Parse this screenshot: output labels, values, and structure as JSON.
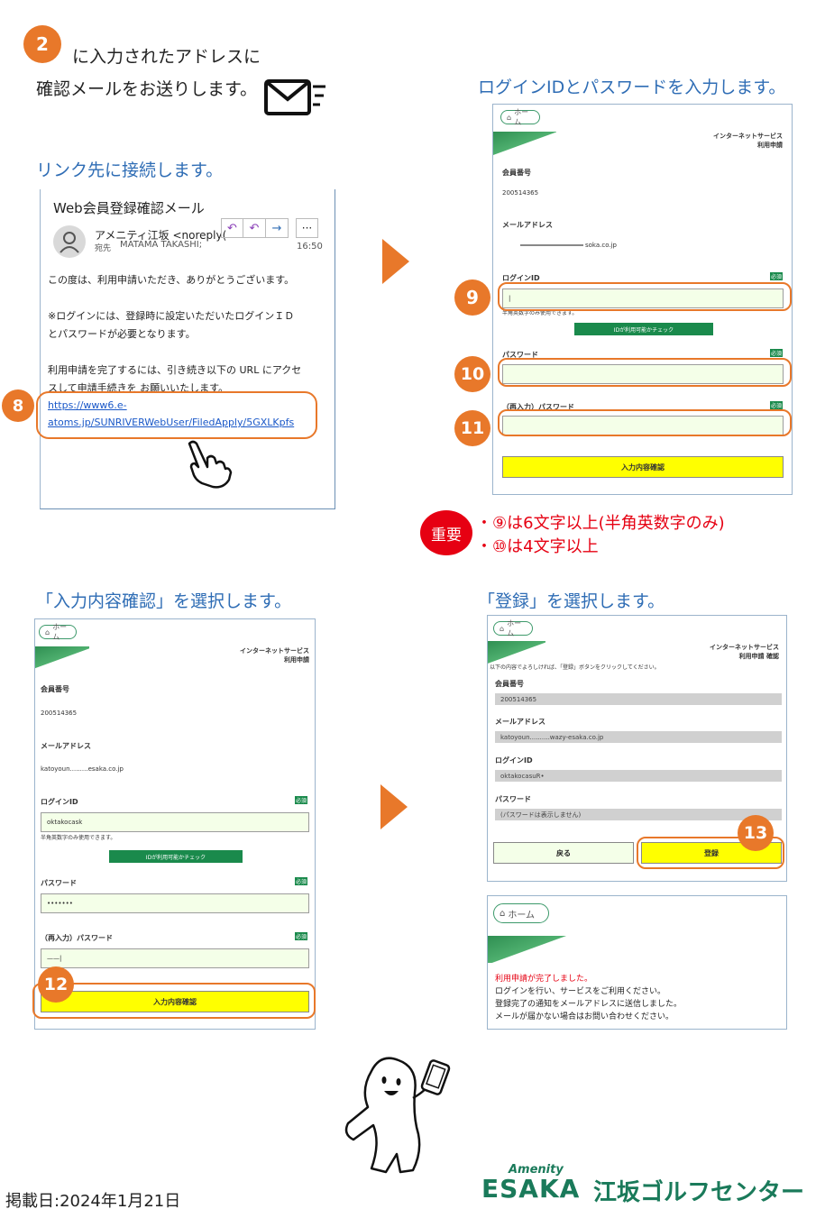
{
  "step2": {
    "number": "2",
    "line1": "に入力されたアドレスに",
    "line2": "確認メールをお送りします。"
  },
  "captions": {
    "link": "リンク先に接続します。",
    "login": "ログインIDとパスワードを入力します。",
    "confirm": "「入力内容確認」を選択します。",
    "register": "「登録」を選択します。"
  },
  "email": {
    "subject": "Web会員登録確認メール",
    "from": "アメニティ江坂 <noreply(",
    "to_label": "宛先",
    "to_value": "MATAMA TAKASHI;",
    "time": "16:50",
    "body1": "この度は、利用申請いただき、ありがとうございます。",
    "body2a": "※ログインには、登録時に設定いただいたログインＩＤ",
    "body2b": "とパスワードが必要となります。",
    "body3a": "利用申請を完了するには、引き続き以下の URL にアクセ",
    "body3b": "スして申請手続きを お願いいたします。",
    "link_a": "https://www6.e-",
    "link_b": "atoms.jp/SUNRIVERWebUser/FiledApply/5GXLKpfs"
  },
  "steps": {
    "s8": "8",
    "s9": "9",
    "s10": "10",
    "s11": "11",
    "s12": "12",
    "s13": "13"
  },
  "form1": {
    "home": "ホーム",
    "service": "インターネットサービス",
    "service_sub": "利用申請",
    "member_no_label": "会員番号",
    "member_no": "200514365",
    "email_label": "メールアドレス",
    "email_value": "soka.co.jp",
    "login_label": "ログインID",
    "required": "必須",
    "login_hint": "半角英数字のみ使用できます。",
    "check_btn": "IDが利用可能かチェック",
    "password_label": "パスワード",
    "repass_label": "（再入力）パスワード",
    "confirm_btn": "入力内容確認"
  },
  "important": {
    "badge": "重要",
    "line1": "・⑨は6文字以上(半角英数字のみ)",
    "line2": "・⑩は4文字以上"
  },
  "form2": {
    "home": "ホーム",
    "service": "インターネットサービス",
    "service_sub": "利用申請",
    "member_no_label": "会員番号",
    "member_no": "200514365",
    "email_label": "メールアドレス",
    "email_value": "katoyoun.........esaka.co.jp",
    "login_label": "ログインID",
    "required": "必須",
    "login_value": "oktakocask",
    "login_hint": "半角英数字のみ使用できます。",
    "check_btn": "IDが利用可能かチェック",
    "password_label": "パスワード",
    "password_value": "•••••••",
    "repass_label": "（再入力）パスワード",
    "repass_value": "——|",
    "confirm_btn": "入力内容確認"
  },
  "form3": {
    "home": "ホーム",
    "service": "インターネットサービス",
    "service_sub": "利用申請 確認",
    "note": "以下の内容でよろしければ、「登録」ボタンをクリックしてください。",
    "member_no_label": "会員番号",
    "member_no": "200514365",
    "email_label": "メールアドレス",
    "email_value": "katoyoun..........wazy-esaka.co.jp",
    "login_label": "ログインID",
    "login_value": "oktakocasuR•",
    "password_label": "パスワード",
    "password_value": "(パスワードは表示しません)",
    "back_btn": "戻る",
    "register_btn": "登録"
  },
  "complete": {
    "home": "ホーム",
    "line1": "利用申請が完了しました。",
    "line2": "ログインを行い、サービスをご利用ください。",
    "line3": "登録完了の通知をメールアドレスに送信しました。",
    "line4": "メールが届かない場合はお問い合わせください。"
  },
  "footer": {
    "date": "掲載日:2024年1月21日",
    "brand_small": "Amenity",
    "brand_big": "ESAKA",
    "brand_jp": "江坂ゴルフセンター"
  },
  "colors": {
    "accent": "#e8782a",
    "caption_blue": "#2f6db5",
    "green": "#1a8a4c",
    "yellow": "#ffff00",
    "red": "#e60012"
  }
}
